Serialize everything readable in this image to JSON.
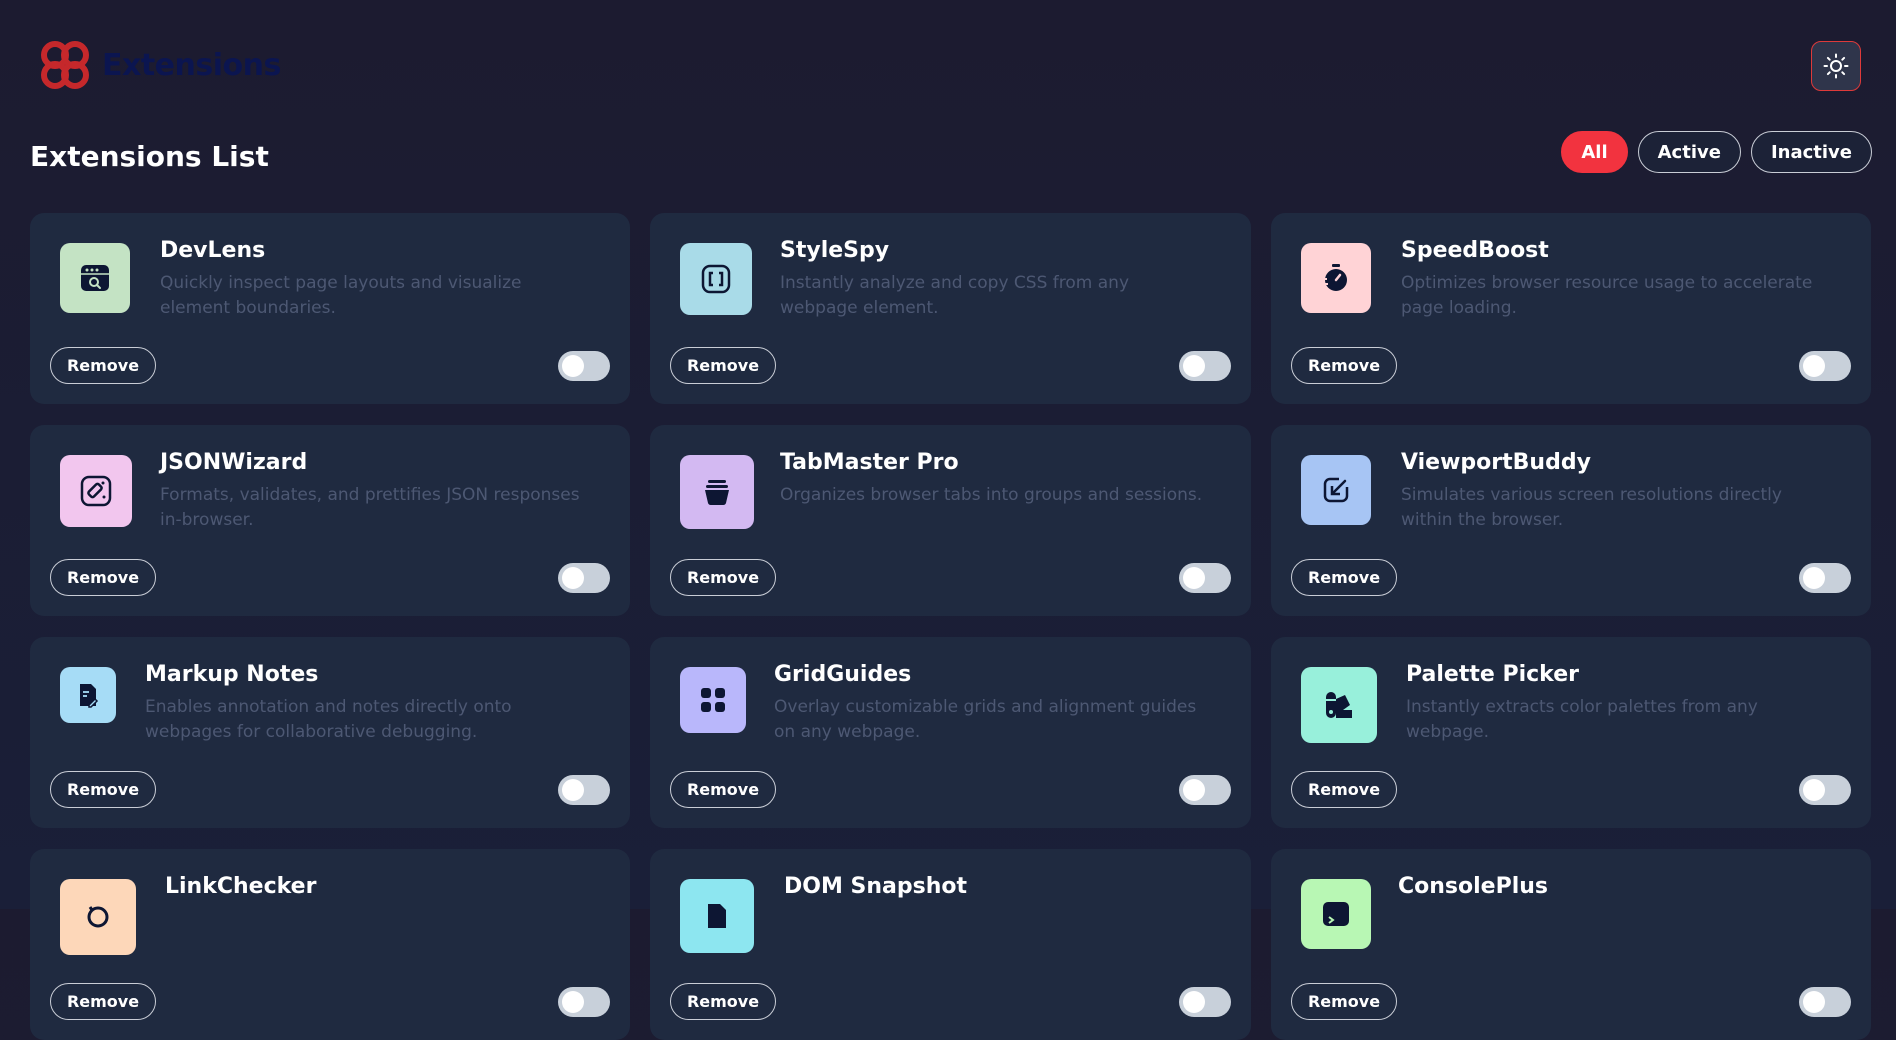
{
  "header": {
    "logo_text": "Extensions",
    "theme_icon": "sun-icon"
  },
  "list": {
    "title": "Extensions List",
    "filters": [
      {
        "label": "All",
        "active": true
      },
      {
        "label": "Active",
        "active": false
      },
      {
        "label": "Inactive",
        "active": false
      }
    ]
  },
  "cards": [
    {
      "name": "DevLens",
      "description": "Quickly inspect page layouts and visualize element boundaries.",
      "remove_label": "Remove",
      "icon": "inspect-window-icon",
      "icon_bg": "#c4e3c4",
      "enabled": false
    },
    {
      "name": "StyleSpy",
      "description": "Instantly analyze and copy CSS from any webpage element.",
      "remove_label": "Remove",
      "icon": "brackets-icon",
      "icon_bg": "#a9dbe8",
      "enabled": false
    },
    {
      "name": "SpeedBoost",
      "description": "Optimizes browser resource usage to accelerate page loading.",
      "remove_label": "Remove",
      "icon": "stopwatch-icon",
      "icon_bg": "#ffd3d6",
      "enabled": false
    },
    {
      "name": "JSONWizard",
      "description": "Formats, validates, and prettifies JSON responses in-browser.",
      "remove_label": "Remove",
      "icon": "wand-icon",
      "icon_bg": "#f2c6ee",
      "enabled": false
    },
    {
      "name": "TabMaster Pro",
      "description": "Organizes browser tabs into groups and sessions.",
      "remove_label": "Remove",
      "icon": "tab-stack-icon",
      "icon_bg": "#d3b9f2",
      "enabled": false
    },
    {
      "name": "ViewportBuddy",
      "description": "Simulates various screen resolutions directly within the browser.",
      "remove_label": "Remove",
      "icon": "resize-arrow-icon",
      "icon_bg": "#a7c5f4",
      "enabled": false
    },
    {
      "name": "Markup Notes",
      "description": "Enables annotation and notes directly onto webpages for collaborative debugging.",
      "remove_label": "Remove",
      "icon": "note-pen-icon",
      "icon_bg": "#a6dcf6",
      "enabled": false
    },
    {
      "name": "GridGuides",
      "description": "Overlay customizable grids and alignment guides on any webpage.",
      "remove_label": "Remove",
      "icon": "grid-blocks-icon",
      "icon_bg": "#b9b7fb",
      "enabled": false
    },
    {
      "name": "Palette Picker",
      "description": "Instantly extracts color palettes from any webpage.",
      "remove_label": "Remove",
      "icon": "palette-icon",
      "icon_bg": "#98f0db",
      "enabled": false
    },
    {
      "name": "LinkChecker",
      "description": "",
      "remove_label": "Remove",
      "icon": "link-check-icon",
      "icon_bg": "#fdd7b9",
      "enabled": false
    },
    {
      "name": "DOM Snapshot",
      "description": "",
      "remove_label": "Remove",
      "icon": "snapshot-icon",
      "icon_bg": "#8de6f0",
      "enabled": false
    },
    {
      "name": "ConsolePlus",
      "description": "",
      "remove_label": "Remove",
      "icon": "console-icon",
      "icon_bg": "#b8f7b4",
      "enabled": false
    }
  ]
}
